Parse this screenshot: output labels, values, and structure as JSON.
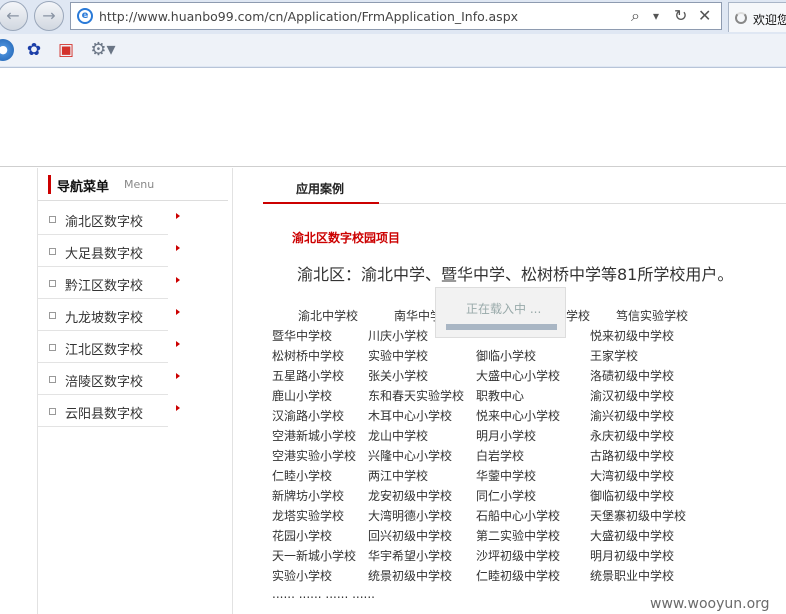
{
  "browser": {
    "url": "http://www.huanbo99.com/cn/Application/FrmApplication_Info.aspx",
    "tab_title": "欢迎您",
    "back_icon": "←",
    "forward_icon": "→",
    "search_icon": "⌕",
    "dropdown_icon": "▾",
    "refresh_icon": "↻",
    "stop_icon": "✕",
    "ie_icon": "e",
    "cmd_icons": [
      "●",
      "✿",
      "▣",
      "⚙▾"
    ]
  },
  "sidebar": {
    "title": "导航菜单",
    "subtitle": "Menu",
    "items": [
      {
        "label": "渝北区数字校"
      },
      {
        "label": "大足县数字校"
      },
      {
        "label": "黔江区数字校"
      },
      {
        "label": "九龙坡数字校"
      },
      {
        "label": "江北区数字校"
      },
      {
        "label": "涪陵区数字校"
      },
      {
        "label": "云阳县数字校"
      }
    ]
  },
  "main": {
    "tab_label": "应用案例",
    "project_title": "渝北区数字校园项目",
    "summary": "渝北区：渝北中学、暨华中学、松树桥中学等81所学校用户。",
    "header_row": [
      "渝北中学校",
      "南华中学",
      "学校",
      "笃信实验学校"
    ],
    "rows": [
      [
        "暨华中学校",
        "川庆小学校",
        "",
        "悦来初级中学校"
      ],
      [
        "松树桥中学校",
        "实验中学校",
        "御临小学校",
        "王家学校"
      ],
      [
        "五星路小学校",
        "张关小学校",
        "大盛中心小学校",
        "洛碛初级中学校"
      ],
      [
        "鹿山小学校",
        "东和春天实验学校",
        "职教中心",
        "渝汉初级中学校"
      ],
      [
        "汉渝路小学校",
        "木耳中心小学校",
        "悦来中心小学校",
        "渝兴初级中学校"
      ],
      [
        "空港新城小学校",
        "龙山中学校",
        "明月小学校",
        "永庆初级中学校"
      ],
      [
        "空港实验小学校",
        "兴隆中心小学校",
        "白岩学校",
        "古路初级中学校"
      ],
      [
        "仁睦小学校",
        "两江中学校",
        "华蓥中学校",
        "大湾初级中学校"
      ],
      [
        "新牌坊小学校",
        "龙安初级中学校",
        "同仁小学校",
        "御临初级中学校"
      ],
      [
        "龙塔实验学校",
        "大湾明德小学校",
        "石船中心小学校",
        "天堡寨初级中学校"
      ],
      [
        "花园小学校",
        "回兴初级中学校",
        "第二实验中学校",
        "大盛初级中学校"
      ],
      [
        "天一新城小学校",
        "华宇希望小学校",
        "沙坪初级中学校",
        "明月初级中学校"
      ],
      [
        "实验小学校",
        "统景初级中学校",
        "仁睦初级中学校",
        "统景职业中学校"
      ]
    ],
    "ellipsis": "...... ...... ...... ......"
  },
  "loading": {
    "text": "正在载入中 ..."
  },
  "watermark": "www.wooyun.org"
}
